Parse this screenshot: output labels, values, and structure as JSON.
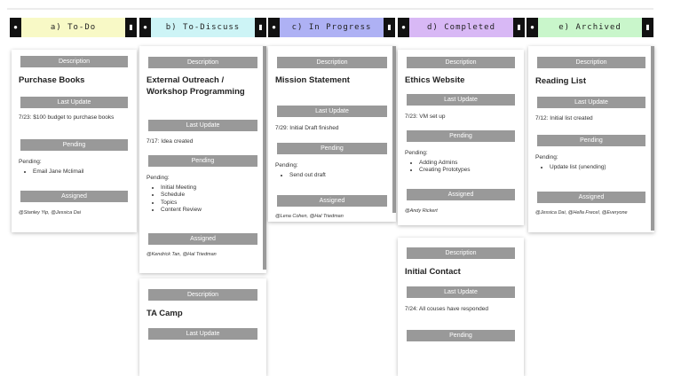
{
  "labels": {
    "description": "Description",
    "last_update": "Last Update",
    "pending": "Pending",
    "assigned": "Assigned"
  },
  "columns": [
    {
      "title": "a) To-Do",
      "color": "#f8f9c6",
      "cards": [
        {
          "title": "Purchase Books",
          "last_update": "7/23: $100 budget to purchase books",
          "pending_intro": "Pending:",
          "pending_items": [
            "Email Jane Mclimail"
          ],
          "assigned": "@Stanley Yip, @Jessica Dai"
        }
      ]
    },
    {
      "title": "b) To-Discuss",
      "color": "#cdf4f6",
      "cards": [
        {
          "title": "External Outreach / Workshop Programming",
          "last_update": "7/17: Idea created",
          "pending_intro": "Pending:",
          "pending_items": [
            "Initial Meeting",
            "Schedule",
            "Topics",
            "Content Review"
          ],
          "assigned": "@Kendrick Tan, @Hal Triedman"
        },
        {
          "title": "TA Camp"
        }
      ]
    },
    {
      "title": "c) In Progress",
      "color": "#aeb1f4",
      "cards": [
        {
          "title": "Mission Statement",
          "last_update": "7/29: Initial Draft finished",
          "pending_intro": "Pending:",
          "pending_items": [
            "Send out draft"
          ],
          "assigned": "@Lena Cohen, @Hal Triedman"
        }
      ]
    },
    {
      "title": "d) Completed",
      "color": "#d8b8f5",
      "cards": [
        {
          "title": "Ethics Website",
          "last_update": "7/23: VM set up",
          "pending_intro": "Pending:",
          "pending_items": [
            "Adding Admins",
            "Creating Prototypes"
          ],
          "assigned": "@Andy Rickert"
        },
        {
          "title": "Initial Contact",
          "last_update": "7/24: All couses have responded"
        }
      ]
    },
    {
      "title": "e) Archived",
      "color": "#c9f6cb",
      "cards": [
        {
          "title": "Reading List",
          "last_update": "7/12: Initial list created",
          "pending_intro": "Pending:",
          "pending_items": [
            "Update list (unending)"
          ],
          "assigned": "@Jessica Dai, @Hella Frecel, @Everyone"
        }
      ]
    }
  ],
  "icons": {
    "left_button": "pin-icon",
    "right_button": "trash-icon"
  }
}
